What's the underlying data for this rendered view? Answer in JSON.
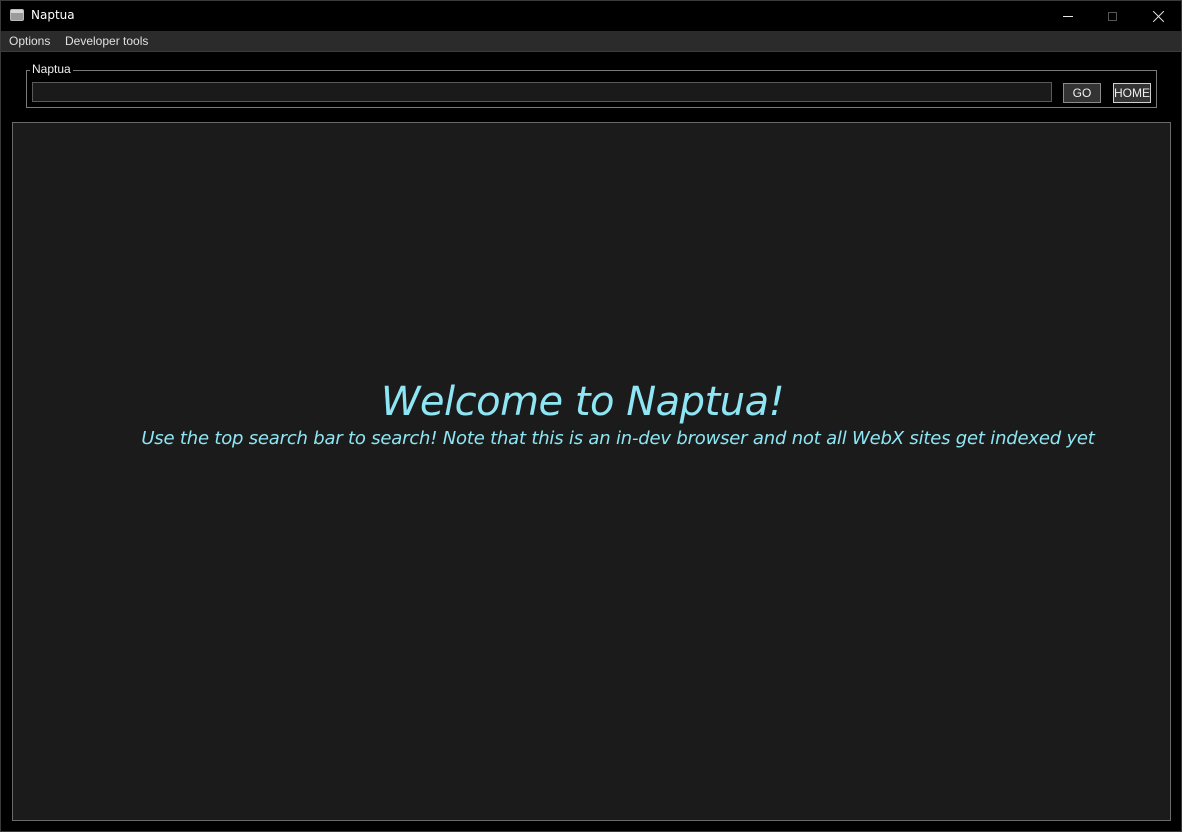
{
  "window": {
    "title": "Naptua",
    "icon": "app-window-icon"
  },
  "menu": {
    "items": [
      "Options",
      "Developer tools"
    ]
  },
  "toolbar": {
    "group_label": "Naptua",
    "search_value": "",
    "search_placeholder": "",
    "go_label": "GO",
    "home_label": "HOME"
  },
  "page": {
    "heading": "Welcome to Naptua!",
    "subheading": "Use the top search bar to search! Note that this is an in-dev browser and not all WebX sites get indexed yet"
  },
  "colors": {
    "background": "#000000",
    "content_background": "#1b1b1b",
    "accent_text": "#8ee6f4"
  }
}
